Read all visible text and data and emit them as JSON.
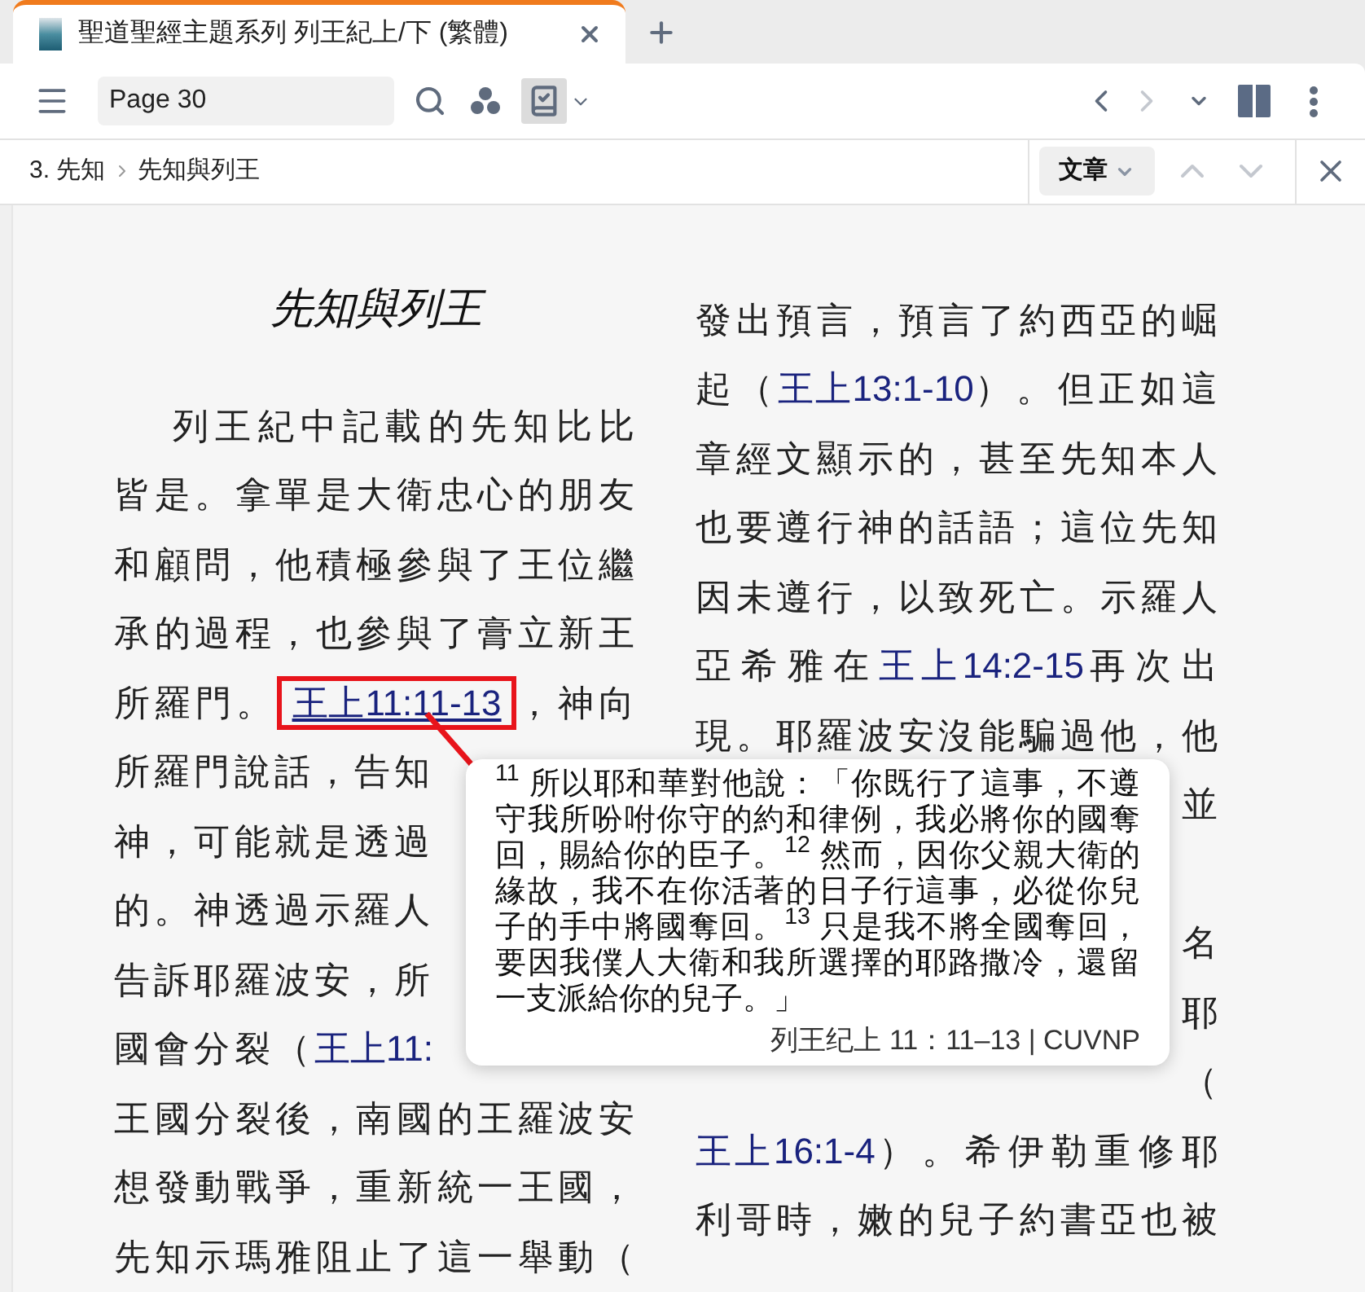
{
  "tab": {
    "title": "聖道聖經主題系列 列王紀上/下 (繁體)",
    "selected": true
  },
  "toolbar": {
    "page_field": {
      "value": "Page 30"
    },
    "toggle_on": true,
    "back_disabled": false,
    "forward_disabled": true
  },
  "breadcrumb": {
    "items": [
      "3. 先知",
      "先知與列王"
    ],
    "section_button": "文章",
    "prev_disabled": true,
    "next_disabled": true
  },
  "left_column": {
    "title": "先知與列王",
    "lines": [
      {
        "kind": "full",
        "segments": [
          {
            "kind": "text",
            "text": "列王紀中記載的先知比比"
          }
        ]
      },
      {
        "kind": "full",
        "segments": [
          {
            "kind": "text",
            "text": "皆是。拿單是大衛忠心的朋友"
          }
        ]
      },
      {
        "kind": "full",
        "segments": [
          {
            "kind": "text",
            "text": "和顧問，他積極參與了王位繼"
          }
        ]
      },
      {
        "kind": "full",
        "segments": [
          {
            "kind": "text",
            "text": "承的過程，也參與了膏立新王"
          }
        ]
      },
      {
        "kind": "full",
        "segments": [
          {
            "kind": "text",
            "text": "所羅門。"
          },
          {
            "kind": "ref",
            "text": "王上11:11-13",
            "highlighted": true
          },
          {
            "kind": "text",
            "text": "，神向"
          }
        ]
      },
      {
        "kind": "start",
        "segments": [
          {
            "kind": "text",
            "text": "所羅門說話，告知"
          }
        ]
      },
      {
        "kind": "start",
        "segments": [
          {
            "kind": "text",
            "text": "神，可能就是透過"
          }
        ]
      },
      {
        "kind": "start",
        "segments": [
          {
            "kind": "text",
            "text": "的。神透過示羅人"
          }
        ]
      },
      {
        "kind": "start",
        "segments": [
          {
            "kind": "text",
            "text": "告訴耶羅波安，所"
          }
        ]
      },
      {
        "kind": "start",
        "segments": [
          {
            "kind": "text",
            "text": "國會分裂（"
          },
          {
            "kind": "ref",
            "text": "王上11:",
            "highlighted": false
          }
        ]
      },
      {
        "kind": "full",
        "segments": [
          {
            "kind": "text",
            "text": "王國分裂後，南國的王羅波安"
          }
        ]
      },
      {
        "kind": "full",
        "segments": [
          {
            "kind": "text",
            "text": "想發動戰爭，重新統一王國，"
          }
        ]
      },
      {
        "kind": "full",
        "segments": [
          {
            "kind": "text",
            "text": "先知示瑪雅阻止了這一舉動（"
          }
        ]
      }
    ]
  },
  "right_column": {
    "lines": [
      {
        "kind": "full",
        "segments": [
          {
            "kind": "text",
            "text": "發出預言，預言了約西亞的崛"
          }
        ]
      },
      {
        "kind": "full",
        "segments": [
          {
            "kind": "text",
            "text": "起（"
          },
          {
            "kind": "ref",
            "text": "王上13:1-10",
            "highlighted": false
          },
          {
            "kind": "text",
            "text": "）。但正如這"
          }
        ]
      },
      {
        "kind": "full",
        "segments": [
          {
            "kind": "text",
            "text": "章經文顯示的，甚至先知本人"
          }
        ]
      },
      {
        "kind": "full",
        "segments": [
          {
            "kind": "text",
            "text": "也要遵行神的話語；這位先知"
          }
        ]
      },
      {
        "kind": "full",
        "segments": [
          {
            "kind": "text",
            "text": "因未遵行，以致死亡。示羅人"
          }
        ]
      },
      {
        "kind": "full",
        "segments": [
          {
            "kind": "text",
            "text": "亞希雅在"
          },
          {
            "kind": "ref",
            "text": "王上14:2-15",
            "highlighted": false
          },
          {
            "kind": "text",
            "text": "再次出"
          }
        ]
      },
      {
        "kind": "full",
        "segments": [
          {
            "kind": "text",
            "text": "現。耶羅波安沒能騙過他，他"
          }
        ]
      },
      {
        "kind": "end",
        "segments": [
          {
            "kind": "text",
            "text": "並"
          }
        ]
      },
      {
        "kind": "hidden"
      },
      {
        "kind": "end",
        "segments": [
          {
            "kind": "text",
            "text": "名"
          }
        ]
      },
      {
        "kind": "end",
        "segments": [
          {
            "kind": "text",
            "text": "耶"
          }
        ]
      },
      {
        "kind": "end",
        "segments": [
          {
            "kind": "text",
            "text": "（"
          }
        ]
      },
      {
        "kind": "full",
        "segments": [
          {
            "kind": "ref",
            "text": "王上16:1-4",
            "highlighted": false
          },
          {
            "kind": "text",
            "text": "）。希伊勒重修耶"
          }
        ]
      },
      {
        "kind": "full",
        "segments": [
          {
            "kind": "text",
            "text": "利哥時，嫩的兒子約書亞也被"
          }
        ]
      }
    ]
  },
  "popup": {
    "text": "$^{11}$ 所以耶和華對他說：「你既行了這事，不遵守我所吩咐你守的約和律例，我必將你的國奪回，賜給你的臣子。$^{12}$ 然而，因你父親大衛的緣故，我不在你活著的日子行這事，必從你兒子的手中將國奪回。$^{13}$ 只是我不將全國奪回，要因我僕人大衛和我所選擇的耶路撒冷，還留一支派給你的兒子。」",
    "citation": "列王纪上 11：11–13 | CUVNP"
  }
}
